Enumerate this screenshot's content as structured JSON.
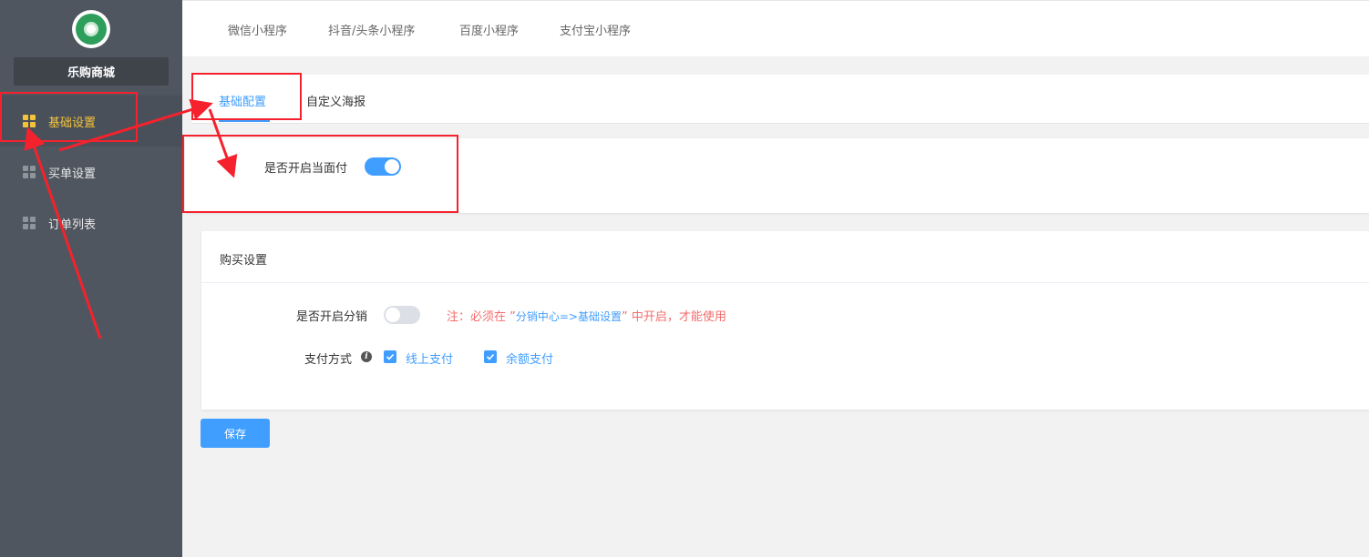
{
  "sidebar": {
    "shop_name": "乐购商城",
    "items": [
      {
        "label": "基础设置",
        "active": true,
        "icon": "grid-icon"
      },
      {
        "label": "买单设置",
        "active": false,
        "icon": "grid-icon"
      },
      {
        "label": "订单列表",
        "active": false,
        "icon": "grid-icon"
      }
    ]
  },
  "top_tabs": [
    "微信小程序",
    "抖音/头条小程序",
    "百度小程序",
    "支付宝小程序"
  ],
  "sub_tabs": [
    {
      "label": "基础配置",
      "active": true
    },
    {
      "label": "自定义海报",
      "active": false
    }
  ],
  "face_pay": {
    "label": "是否开启当面付",
    "enabled": true
  },
  "purchase": {
    "title": "购买设置",
    "distribution_label": "是否开启分销",
    "distribution_enabled": false,
    "note_prefix": "注：必须在 ”",
    "note_link": "分销中心=>基础设置",
    "note_suffix": "” 中开启，才能使用",
    "payment_label": "支付方式",
    "payment_options": [
      {
        "label": "线上支付",
        "checked": true
      },
      {
        "label": "余额支付",
        "checked": true
      }
    ]
  },
  "save_label": "保存",
  "colors": {
    "sidebar_bg": "#50565f",
    "accent": "#409eff",
    "active_nav": "#f4c33a",
    "warning": "#f56c6c",
    "annotation": "#f5222d"
  }
}
